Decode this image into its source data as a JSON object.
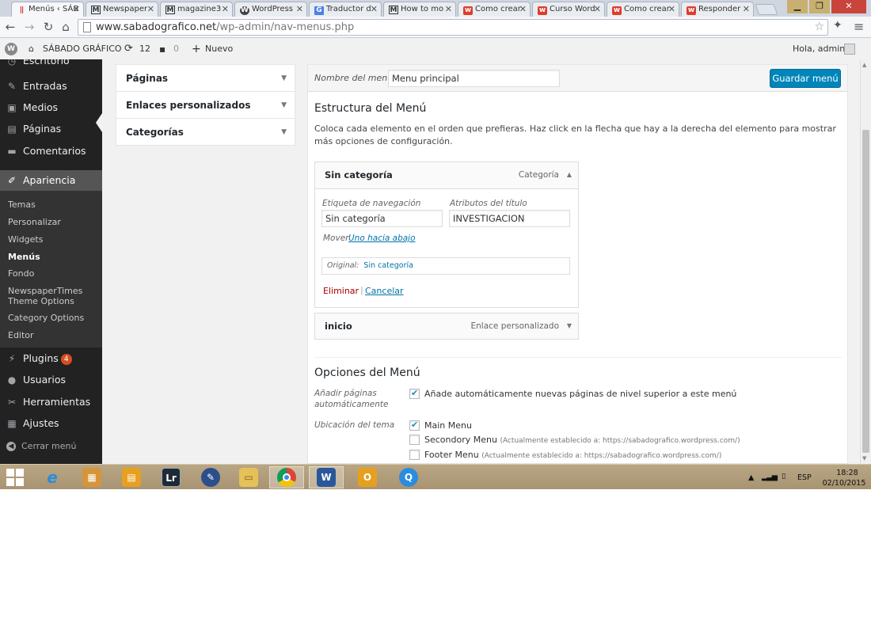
{
  "browser": {
    "tabs": [
      {
        "title": "Menús ‹ SÁB",
        "icon": "bar-icon",
        "active": true
      },
      {
        "title": "Newspaper",
        "icon": "m-icon"
      },
      {
        "title": "magazine3",
        "icon": "m-icon"
      },
      {
        "title": "WordPress",
        "icon": "wordpress-icon"
      },
      {
        "title": "Traductor d",
        "icon": "translate-icon"
      },
      {
        "title": "How to mo",
        "icon": "m-icon"
      },
      {
        "title": "Como crear",
        "icon": "w-icon"
      },
      {
        "title": "Curso Word",
        "icon": "w-icon"
      },
      {
        "title": "Como crear",
        "icon": "w-icon"
      },
      {
        "title": "Responder",
        "icon": "w-icon"
      }
    ],
    "url_host": "www.sabadografico.net",
    "url_path": "/wp-admin/nav-menus.php"
  },
  "adminbar": {
    "site": "SÁBADO GRÁFICO",
    "updates": "12",
    "comments": "0",
    "new": "Nuevo",
    "greeting": "Hola, admin"
  },
  "sidebar": {
    "top_cut": "Escritorio",
    "items": [
      {
        "label": "Entradas",
        "icon": "pin-icon"
      },
      {
        "label": "Medios",
        "icon": "media-icon"
      },
      {
        "label": "Páginas",
        "icon": "pages-icon"
      },
      {
        "label": "Comentarios",
        "icon": "comment-icon"
      },
      {
        "label": "Apariencia",
        "icon": "brush-icon"
      }
    ],
    "submenu": [
      "Temas",
      "Personalizar",
      "Widgets",
      "Menús",
      "Fondo",
      "NewspaperTimes Theme Options",
      "Category Options",
      "Editor"
    ],
    "items2": [
      {
        "label": "Plugins",
        "icon": "plugin-icon",
        "badge": "4"
      },
      {
        "label": "Usuarios",
        "icon": "user-icon"
      },
      {
        "label": "Herramientas",
        "icon": "tools-icon"
      },
      {
        "label": "Ajustes",
        "icon": "settings-icon"
      }
    ],
    "collapse": "Cerrar menú"
  },
  "accordion": [
    "Páginas",
    "Enlaces personalizados",
    "Categorías"
  ],
  "menu": {
    "name_label": "Nombre del menú",
    "name_value": "Menu principal",
    "save": "Guardar menú",
    "structure_title": "Estructura del Menú",
    "structure_desc": "Coloca cada elemento en el orden que prefieras. Haz click en la flecha que hay a la derecha del elemento para mostrar más opciones de configuración.",
    "item1": {
      "title": "Sin categoría",
      "type": "Categoría",
      "nav_label_lbl": "Etiqueta de navegación",
      "nav_label_val": "Sin categoría",
      "title_attr_lbl": "Atributos del título",
      "title_attr_val": "INVESTIGACION",
      "move_lbl": "Mover",
      "move_link": "Uno hacia abajo",
      "original_lbl": "Original:",
      "original_link": "Sin categoría",
      "delete": "Eliminar",
      "sep": "|",
      "cancel": "Cancelar"
    },
    "item2": {
      "title": "inicio",
      "type": "Enlace personalizado"
    },
    "options_title": "Opciones del Menú",
    "auto_add_lbl": "Añadir páginas automáticamente",
    "auto_add_txt": "Añade automáticamente nuevas páginas de nivel superior a este menú",
    "location_lbl": "Ubicación del tema",
    "locations": [
      {
        "name": "Main Menu",
        "checked": true,
        "note": ""
      },
      {
        "name": "Secondory Menu",
        "checked": false,
        "note": "(Actualmente establecido a: https://sabadografico.wordpress.com/)"
      },
      {
        "name": "Footer Menu",
        "checked": false,
        "note": "(Actualmente establecido a: https://sabadografico.wordpress.com/)"
      }
    ]
  },
  "taskbar": {
    "tray_lang": "ESP",
    "time": "18:28",
    "date": "02/10/2015"
  }
}
